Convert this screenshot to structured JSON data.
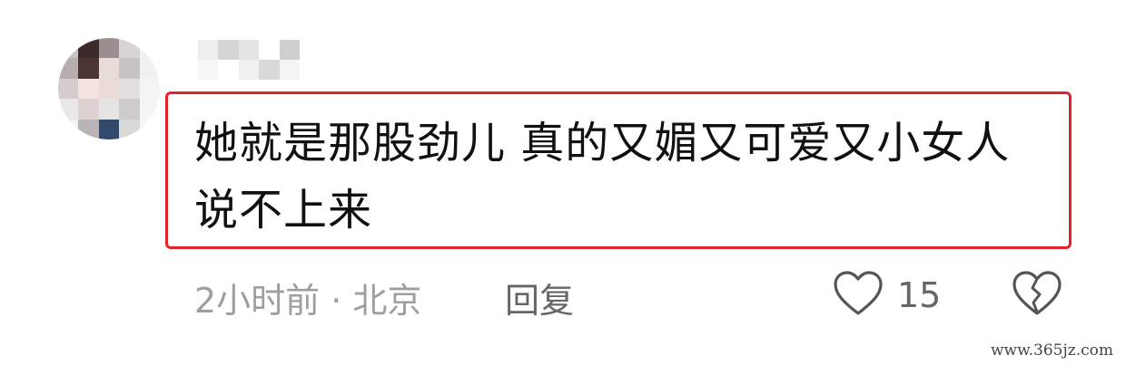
{
  "comment": {
    "text_line1": "她就是那股劲儿 真的又媚又可爱又小女人",
    "text_line2": "说不上来",
    "time_location": "2小时前 · 北京",
    "reply_label": "回复",
    "like_count": "15",
    "highlight_color": "#e0232a"
  },
  "icons": {
    "like": "heart-outline-icon",
    "dislike": "broken-heart-icon"
  },
  "watermark": "www.365jz.com"
}
